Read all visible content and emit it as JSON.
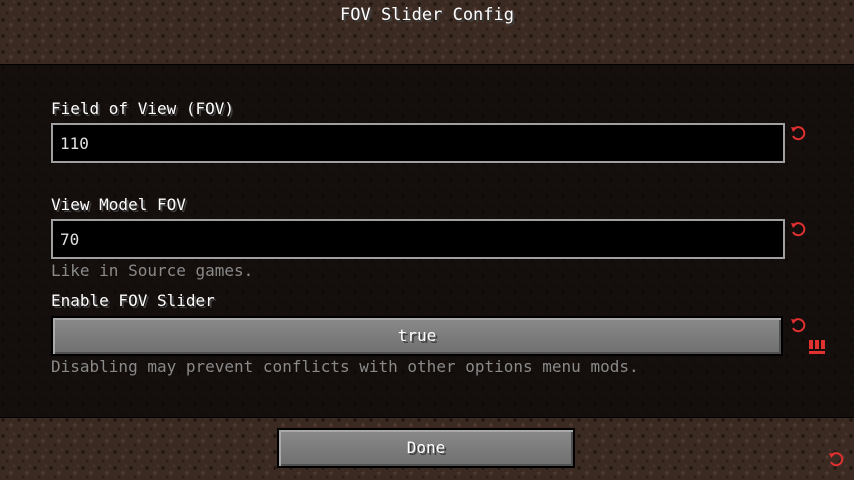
{
  "screen": {
    "title": "FOV Slider Config"
  },
  "options": [
    {
      "label": "Field of View (FOV)",
      "value": "110",
      "reset_icon": "reset-arrow-icon"
    },
    {
      "label": "View Model FOV",
      "value": "70",
      "hint": "Like in Source games.",
      "reset_icon": "reset-arrow-icon"
    },
    {
      "label": "Enable FOV Slider",
      "value": "true",
      "hint": "Disabling may prevent conflicts with other options menu mods.",
      "reset_icon": "reset-arrow-icon",
      "warning_icon": "warning-bars-icon"
    }
  ],
  "footer": {
    "done_label": "Done",
    "reset_all_icon": "reset-arrow-icon"
  },
  "colors": {
    "reset_red": "#e03030",
    "hint_gray": "#8a8a8a",
    "field_border": "#a0a0a0"
  }
}
